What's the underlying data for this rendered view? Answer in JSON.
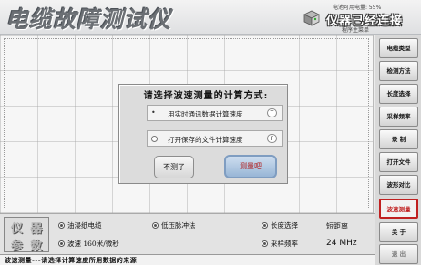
{
  "header": {
    "title": "电缆故障测试仪",
    "battery_text": "电池可用电量: 55%",
    "connection_status": "仪器已经连接",
    "version_text": "程序主菜单"
  },
  "dialog": {
    "title": "请选择波速测量的计算方式:",
    "option1_label": "用实时通讯数据计算速度",
    "option1_key": "T",
    "option2_label": "打开保存的文件计算速度",
    "option2_key": "F",
    "cancel_button": "不测了",
    "confirm_button": "测量吧"
  },
  "sidebar": {
    "items": [
      {
        "label": "电缆类型"
      },
      {
        "label": "检测方法"
      },
      {
        "label": "长度选择"
      },
      {
        "label": "采样频率"
      },
      {
        "label": "录  制"
      },
      {
        "label": "打开文件"
      },
      {
        "label": "波形对比"
      },
      {
        "label": "波速测量"
      },
      {
        "label": "关  于"
      },
      {
        "label": "退  出"
      }
    ]
  },
  "panel": {
    "logo_line1": "仪 器",
    "logo_line2": "参 数",
    "cable_type": "油浸纸电缆",
    "wave_speed": "波速 160米/微秒",
    "method": "低压脉冲法",
    "length_label": "长度选择",
    "length_value": "短距离",
    "sample_label": "采样频率",
    "sample_value": "24 MHz"
  },
  "status_bar": {
    "text": "波速测量---请选择计算速度所用数据的来源"
  }
}
